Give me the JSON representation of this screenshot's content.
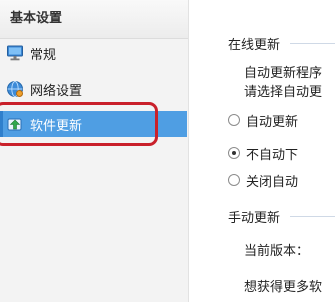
{
  "sidebar": {
    "header": "基本设置",
    "items": [
      {
        "label": "常规",
        "icon": "monitor-icon"
      },
      {
        "label": "网络设置",
        "icon": "globe-network-icon"
      },
      {
        "label": "软件更新",
        "icon": "update-arrow-icon",
        "selected": true
      }
    ],
    "highlight_color": "#c9202a",
    "selected_color": "#4f9ee3"
  },
  "main": {
    "online_update": {
      "title": "在线更新",
      "desc_line1": "自动更新程序",
      "desc_line2": "请选择自动更",
      "options": [
        {
          "label": "自动更新",
          "checked": false
        },
        {
          "label": "不自动下",
          "checked": true
        },
        {
          "label": "关闭自动",
          "checked": false
        }
      ]
    },
    "manual_update": {
      "title": "手动更新",
      "current_version_label": "当前版本：",
      "more_text": "想获得更多软"
    }
  }
}
